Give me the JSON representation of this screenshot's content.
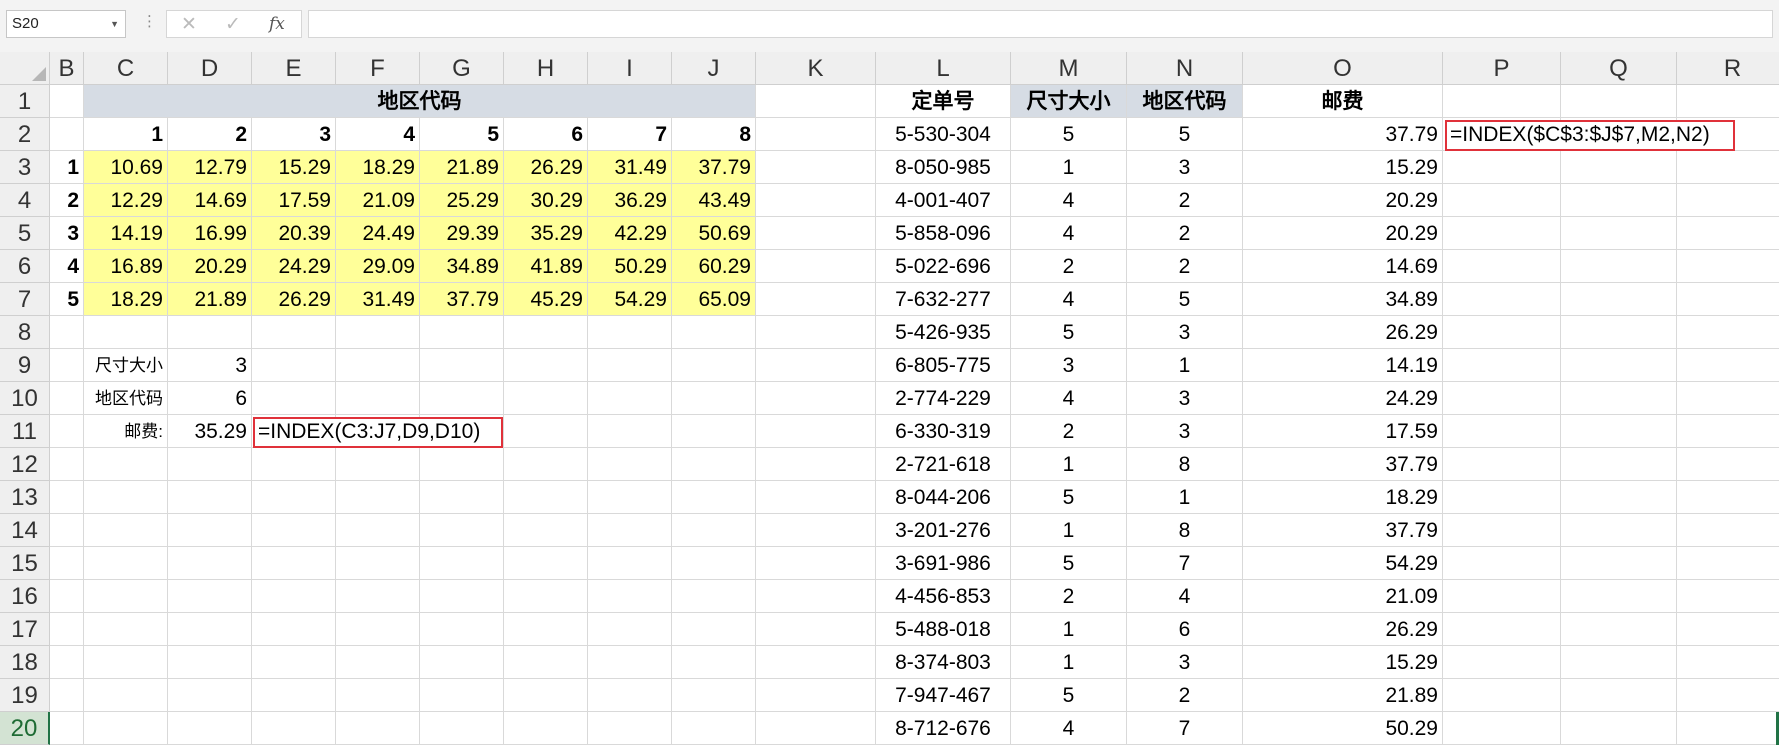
{
  "formula_bar": {
    "name_box": "S20",
    "dots": "⋮",
    "cancel_icon": "✕",
    "enter_icon": "✓",
    "fx_label": "fx",
    "formula": ""
  },
  "columns": [
    "B",
    "C",
    "D",
    "E",
    "F",
    "G",
    "H",
    "I",
    "J",
    "K",
    "L",
    "M",
    "N",
    "O",
    "P",
    "Q",
    "R"
  ],
  "rows": [
    "1",
    "2",
    "3",
    "4",
    "5",
    "6",
    "7",
    "8",
    "9",
    "10",
    "11",
    "12",
    "13",
    "14",
    "15",
    "16",
    "17",
    "18",
    "19",
    "20"
  ],
  "selected_row": "20",
  "left_table": {
    "title": "地区代码",
    "region_codes": [
      "1",
      "2",
      "3",
      "4",
      "5",
      "6",
      "7",
      "8"
    ],
    "size_codes": [
      "1",
      "2",
      "3",
      "4",
      "5"
    ],
    "values": [
      [
        "10.69",
        "12.79",
        "15.29",
        "18.29",
        "21.89",
        "26.29",
        "31.49",
        "37.79"
      ],
      [
        "12.29",
        "14.69",
        "17.59",
        "21.09",
        "25.29",
        "30.29",
        "36.29",
        "43.49"
      ],
      [
        "14.19",
        "16.99",
        "20.39",
        "24.49",
        "29.39",
        "35.29",
        "42.29",
        "50.69"
      ],
      [
        "16.89",
        "20.29",
        "24.29",
        "29.09",
        "34.89",
        "41.89",
        "50.29",
        "60.29"
      ],
      [
        "18.29",
        "21.89",
        "26.29",
        "31.49",
        "37.79",
        "45.29",
        "54.29",
        "65.09"
      ]
    ]
  },
  "lookup": {
    "size_label": "尺寸大小",
    "size_value": "3",
    "region_label": "地区代码",
    "region_value": "6",
    "postage_label": "邮费:",
    "postage_value": "35.29",
    "formula_note": "=INDEX(C3:J7,D9,D10)"
  },
  "right_table": {
    "headers": [
      "定单号",
      "尺寸大小",
      "地区代码",
      "邮费"
    ],
    "formula_note": "=INDEX($C$3:$J$7,M2,N2)",
    "rows": [
      [
        "5-530-304",
        "5",
        "5",
        "37.79"
      ],
      [
        "8-050-985",
        "1",
        "3",
        "15.29"
      ],
      [
        "4-001-407",
        "4",
        "2",
        "20.29"
      ],
      [
        "5-858-096",
        "4",
        "2",
        "20.29"
      ],
      [
        "5-022-696",
        "2",
        "2",
        "14.69"
      ],
      [
        "7-632-277",
        "4",
        "5",
        "34.89"
      ],
      [
        "5-426-935",
        "5",
        "3",
        "26.29"
      ],
      [
        "6-805-775",
        "3",
        "1",
        "14.19"
      ],
      [
        "2-774-229",
        "4",
        "3",
        "24.29"
      ],
      [
        "6-330-319",
        "2",
        "3",
        "17.59"
      ],
      [
        "2-721-618",
        "1",
        "8",
        "37.79"
      ],
      [
        "8-044-206",
        "5",
        "1",
        "18.29"
      ],
      [
        "3-201-276",
        "1",
        "8",
        "37.79"
      ],
      [
        "3-691-986",
        "5",
        "7",
        "54.29"
      ],
      [
        "4-456-853",
        "2",
        "4",
        "21.09"
      ],
      [
        "5-488-018",
        "1",
        "6",
        "26.29"
      ],
      [
        "8-374-803",
        "1",
        "3",
        "15.29"
      ],
      [
        "7-947-467",
        "5",
        "2",
        "21.89"
      ],
      [
        "8-712-676",
        "4",
        "7",
        "50.29"
      ]
    ]
  }
}
